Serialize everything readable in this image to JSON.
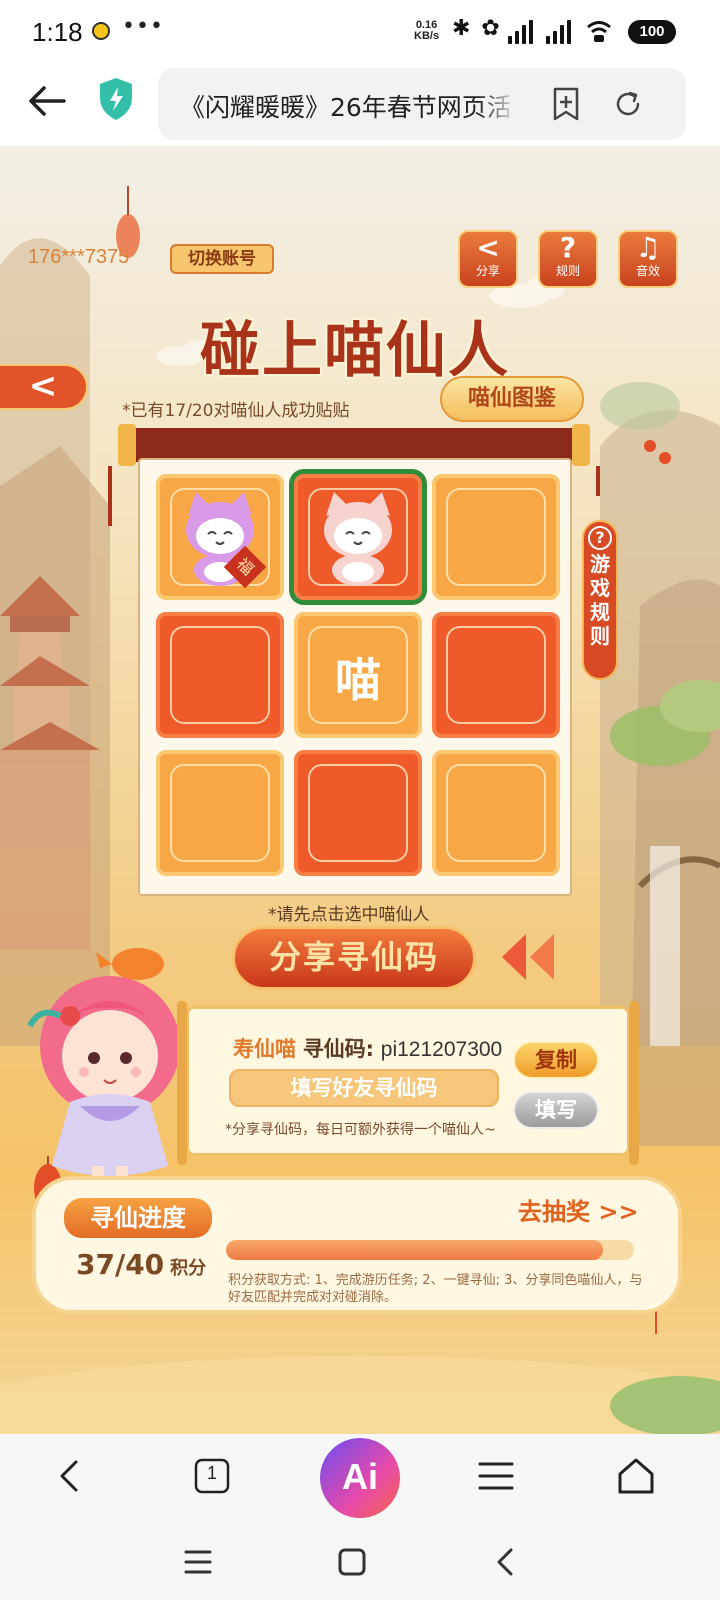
{
  "status_bar": {
    "time": "1:18",
    "dots": "•••",
    "speed_top": "0.16",
    "speed_bottom": "KB/s",
    "battery": "100"
  },
  "browser": {
    "url_title": "《闪耀暖暖》26年春节网页活动"
  },
  "header": {
    "account": "176***7375",
    "switch_account": "切换账号",
    "buttons": [
      {
        "glyph": "<",
        "label": "分享"
      },
      {
        "glyph": "?",
        "label": "规则"
      },
      {
        "glyph": "♫",
        "label": "音效"
      }
    ]
  },
  "title": "碰上喵仙人",
  "back_label": "<",
  "progress_note": "*已有17/20对喵仙人成功贴贴",
  "atlas_button": "喵仙图鉴",
  "side_rules": {
    "q": "?",
    "text": "游戏规则"
  },
  "tiles": [
    {
      "style": "light",
      "content": "cat",
      "cat_color": "#d99be8",
      "badge": "福"
    },
    {
      "style": "red",
      "content": "cat",
      "cat_color": "#f7d3d0",
      "selected": true
    },
    {
      "style": "light",
      "content": "empty"
    },
    {
      "style": "red",
      "content": "empty"
    },
    {
      "style": "light",
      "content": "text",
      "text": "喵"
    },
    {
      "style": "red",
      "content": "empty"
    },
    {
      "style": "light",
      "content": "empty"
    },
    {
      "style": "red",
      "content": "empty"
    },
    {
      "style": "light",
      "content": "empty"
    }
  ],
  "hint": "*请先点击选中喵仙人",
  "share_button": "分享寻仙码",
  "code_panel": {
    "nickname": "寿仙喵",
    "label": "寻仙码:",
    "code": "pi121207300",
    "input_placeholder": "填写好友寻仙码",
    "copy": "复制",
    "fill": "填写",
    "tip": "*分享寻仙码，每日可额外获得一个喵仙人~"
  },
  "progress": {
    "tag": "寻仙进度",
    "value": "37/40",
    "unit": "积分",
    "fraction": 0.925,
    "draw": "去抽奖 >>",
    "rules": "积分获取方式: 1、完成游历任务; 2、一键寻仙; 3、分享同色喵仙人，与好友匹配并完成对对碰消除。"
  },
  "bottom_nav": {
    "tabs_count": "1",
    "ai": "Ai"
  },
  "colors": {
    "accent": "#e1542a",
    "tile_light": "#f8a746",
    "tile_red": "#ee5a2a",
    "selected_border": "#2f8c3a"
  }
}
